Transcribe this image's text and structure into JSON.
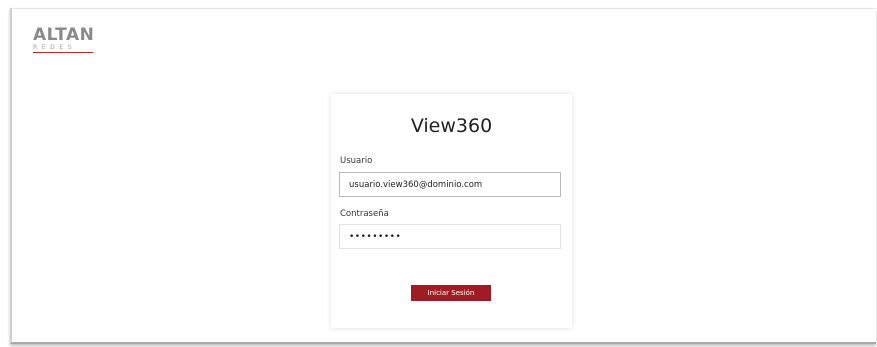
{
  "logo": {
    "main": "ALTAN",
    "sub": "REDES"
  },
  "login": {
    "title": "View360",
    "username_label": "Usuario",
    "username_value": "usuario.view360@dominio.com",
    "password_label": "Contraseña",
    "password_value": "•••••••••",
    "submit_label": "Iniciar Sesión"
  },
  "colors": {
    "brand_red": "#a01c24",
    "logo_gray": "#8a8a8a"
  }
}
